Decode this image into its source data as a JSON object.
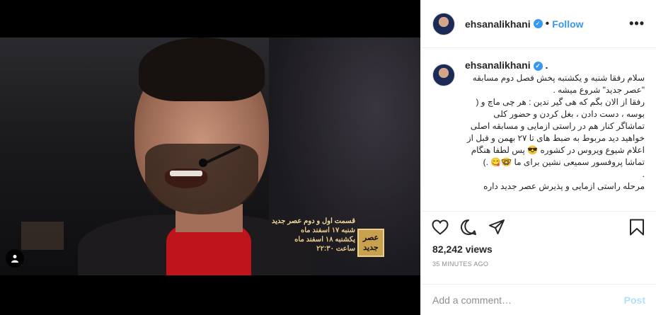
{
  "post": {
    "username": "ehsanalikhani",
    "follow_label": "Follow",
    "more_label": "•••",
    "caption_author": "ehsanalikhani",
    "caption_suffix": " .",
    "caption_text": "سلام رفقا شنبه و یکشنبه پخش فصل دوم مسابقه\n\"عصر جدید\" شروع میشه .\nرفقا از الان بگم که هی گیر ندین : هر چی ماچ و (\nبوسه ، دست دادن ، بغل کردن و حضور کلی\nتماشاگر کنار هم در راستی ازمایی و مسابقه اصلی\nخواهید دید مربوط به ضبط های تا ۲۷ بهمن و قبل از\nاعلام شیوع ویروس در کشوره 😎 پس لطفا هنگام\nتماشا پروفسور سمیعی نشین برای ما 🤓😋 .)\n.\nمرحله راستی ازمایی و پذیرش عصر جدید داره",
    "views": "82,242 views",
    "time_ago": "35 MINUTES AGO",
    "comment_placeholder": "Add a comment…",
    "post_label": "Post"
  },
  "video_overlay": {
    "title": "قسمت اول و دوم عصر جدید",
    "line1": "شنبه ۱۷ اسفند ماه",
    "line2": "یکشنبه ۱۸ اسفند ماه",
    "line3": "ساعت ۲۲:۳۰",
    "logo_text": "عصر جدید"
  },
  "icons": {
    "verified": "verified-badge-icon",
    "like": "heart-icon",
    "comment": "comment-bubble-icon",
    "share": "paper-plane-icon",
    "save": "bookmark-icon",
    "tag": "user-tag-icon"
  },
  "colors": {
    "accent": "#3897f0",
    "post_disabled": "#b2dffc",
    "muted": "#8e8e8e"
  }
}
